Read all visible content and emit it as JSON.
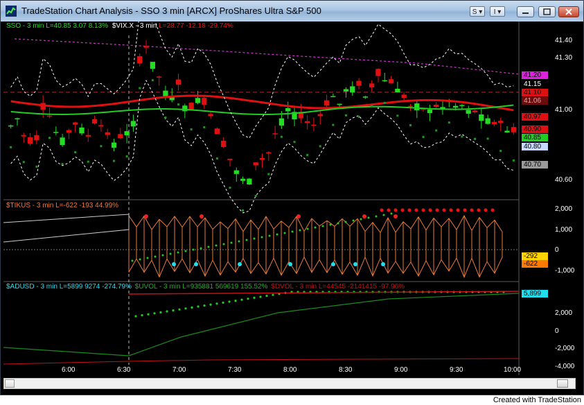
{
  "window": {
    "title": "TradeStation Chart Analysis - SSO 3 min [ARCX] ProShares Ultra S&P 500",
    "btn_s": "S",
    "btn_i": "I"
  },
  "footer": "Created with TradeStation",
  "colors": {
    "background": "#000000",
    "up_candle": "#22dd22",
    "down_candle": "#e01010",
    "vix_line": "#cc1111",
    "adv_green": "#1fae1f",
    "tick_orange": "#e87a3a"
  },
  "legends": {
    "price": {
      "sso": "SSO - 3 min",
      "sso_last": "L=40.85",
      "sso_chg": "3.07",
      "sso_pct": "8.13%",
      "vix": "$VIX.X - 3 min",
      "vix_last": "L=28.77",
      "vix_chg": "-12.18",
      "vix_pct": "-29.74%"
    },
    "tick": {
      "name": "$TIKUS - 3 min",
      "last": "L=-622",
      "chg": "-193",
      "pct": "44.99%"
    },
    "breadth": {
      "adusd": "$ADUSD - 3 min",
      "adusd_last": "L=5899",
      "adusd_chg": "9274",
      "adusd_pct": "-274.79%",
      "uvol": "$UVOL - 3 min",
      "uvol_last": "L=935881",
      "uvol_chg": "569619",
      "uvol_pct": "155.52%",
      "dvol": "$DVOL - 3 min",
      "dvol_last": "L=44545",
      "dvol_chg": "-2141415",
      "dvol_pct": "-97.96%"
    }
  },
  "price_axis": {
    "ticks": [
      "41.40",
      "41.30",
      "41.00",
      "40.60"
    ]
  },
  "price_tags": [
    {
      "text": "41.20",
      "bg": "#dd22dd",
      "fg": "#000000"
    },
    {
      "text": "41.15",
      "bg": "#000000",
      "fg": "#ffffff"
    },
    {
      "text": "41.10",
      "bg": "#dd1111",
      "fg": "#000000"
    },
    {
      "text": "41.06",
      "bg": "#6b0d0d",
      "fg": "#e8a0a0"
    },
    {
      "text": "40.97",
      "bg": "#dd1111",
      "fg": "#000000"
    },
    {
      "text": "40.90",
      "bg": "#dd1111",
      "fg": "#000000"
    },
    {
      "text": "40.85",
      "bg": "#22cc22",
      "fg": "#000000"
    },
    {
      "text": "40.80",
      "bg": "#c8d8ff",
      "fg": "#000000"
    },
    {
      "text": "40.70",
      "bg": "#9a9a9a",
      "fg": "#000000"
    }
  ],
  "tick_axis": {
    "ticks": [
      "2,000",
      "1,000",
      "0",
      "-1,000"
    ]
  },
  "tick_tags": [
    {
      "text": "-292",
      "bg": "#ffd400",
      "fg": "#000000"
    },
    {
      "text": "-622",
      "bg": "#ff7a00",
      "fg": "#000000"
    }
  ],
  "breadth_axis": {
    "ticks": [
      "2,000",
      "0",
      "-2,000",
      "-4,000"
    ]
  },
  "breadth_tags": [
    {
      "text": "5,899",
      "bg": "#22ddee",
      "fg": "#000000"
    }
  ],
  "time_axis": {
    "labels": [
      "6:00",
      "6:30",
      "7:00",
      "7:30",
      "8:00",
      "8:30",
      "9:00",
      "9:30",
      "10:00"
    ]
  }
}
